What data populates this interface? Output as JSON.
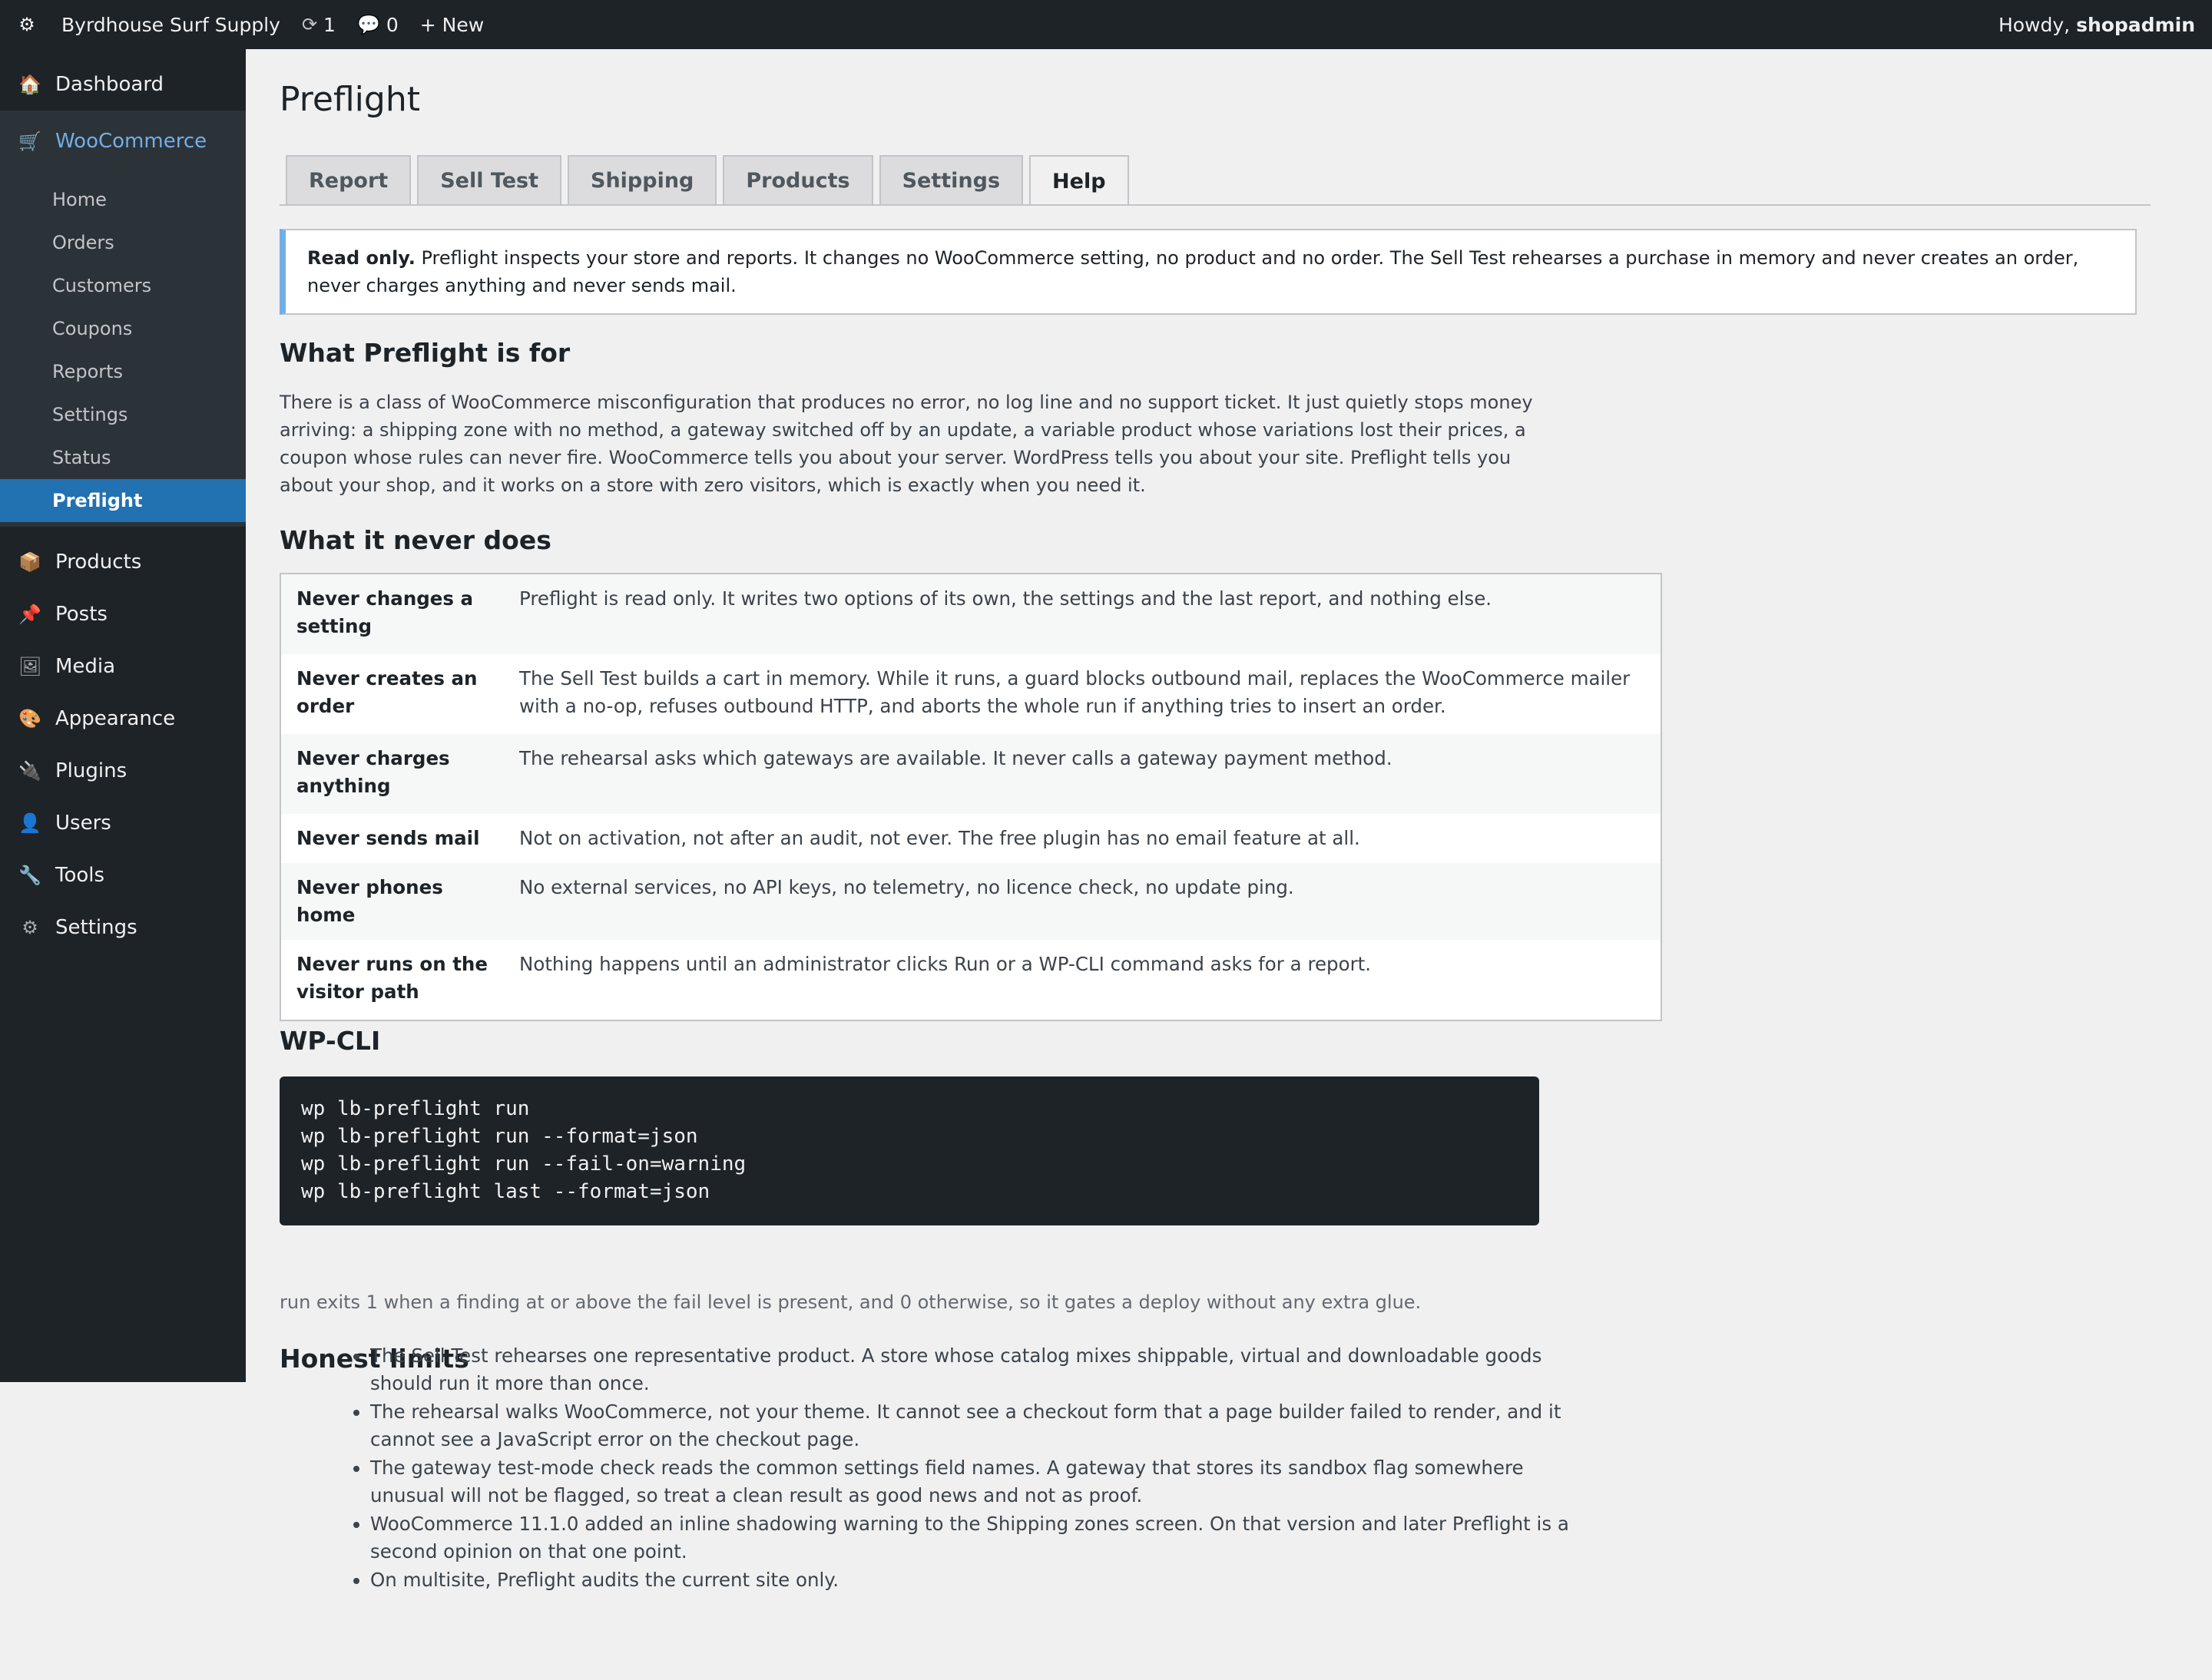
{
  "adminbar": {
    "site_name": "Byrdhouse Surf Supply",
    "updates_count": "1",
    "comments_count": "0",
    "new_label": "+ New",
    "howdy_prefix": "Howdy,",
    "username": "shopadmin"
  },
  "sidebar": {
    "top_items": [
      {
        "label": "Dashboard",
        "icon": "dashboard-icon"
      },
      {
        "label": "WooCommerce",
        "icon": "cart-icon"
      }
    ],
    "woo_submenu": [
      "Home",
      "Orders",
      "Customers",
      "Coupons",
      "Reports",
      "Settings",
      "Status",
      "Preflight"
    ],
    "bottom_items": [
      {
        "label": "Products",
        "icon": "box-icon"
      },
      {
        "label": "Posts",
        "icon": "pin-icon"
      },
      {
        "label": "Media",
        "icon": "media-icon"
      },
      {
        "label": "Appearance",
        "icon": "palette-icon"
      },
      {
        "label": "Plugins",
        "icon": "plug-icon"
      },
      {
        "label": "Users",
        "icon": "user-icon"
      },
      {
        "label": "Tools",
        "icon": "wrench-icon"
      },
      {
        "label": "Settings",
        "icon": "gear-icon"
      }
    ]
  },
  "page": {
    "title": "Preflight",
    "tabs": [
      "Report",
      "Sell Test",
      "Shipping",
      "Products",
      "Settings",
      "Help"
    ],
    "active_tab": "Help"
  },
  "notice": {
    "strong": "Read only.",
    "text": "Preflight inspects your store and reports. It changes no WooCommerce setting, no product and no order. The Sell Test rehearses a purchase in memory and never creates an order, never charges anything and never sends mail."
  },
  "what_for": {
    "heading": "What Preflight is for",
    "body": "There is a class of WooCommerce misconfiguration that produces no error, no log line and no support ticket. It just quietly stops money arriving: a shipping zone with no method, a gateway switched off by an update, a variable product whose variations lost their prices, a coupon whose rules can never fire. WooCommerce tells you about your server. WordPress tells you about your site. Preflight tells you about your shop, and it works on a store with zero visitors, which is exactly when you need it."
  },
  "never": {
    "heading": "What it never does",
    "rows": [
      {
        "k": "Never changes a setting",
        "v": "Preflight is read only. It writes two options of its own, the settings and the last report, and nothing else."
      },
      {
        "k": "Never creates an order",
        "v": "The Sell Test builds a cart in memory. While it runs, a guard blocks outbound mail, replaces the WooCommerce mailer with a no-op, refuses outbound HTTP, and aborts the whole run if anything tries to insert an order."
      },
      {
        "k": "Never charges anything",
        "v": "The rehearsal asks which gateways are available. It never calls a gateway payment method."
      },
      {
        "k": "Never sends mail",
        "v": "Not on activation, not after an audit, not ever. The free plugin has no email feature at all."
      },
      {
        "k": "Never phones home",
        "v": "No external services, no API keys, no telemetry, no licence check, no update ping."
      },
      {
        "k": "Never runs on the visitor path",
        "v": "Nothing happens until an administrator clicks Run or a WP-CLI command asks for a report."
      }
    ]
  },
  "cli": {
    "heading": "WP-CLI",
    "lines": [
      "wp lb-preflight run",
      "wp lb-preflight run --format=json",
      "wp lb-preflight run --fail-on=warning",
      "wp lb-preflight last --format=json"
    ],
    "note": "run exits 1 when a finding at or above the fail level is present, and 0 otherwise, so it gates a deploy without any extra glue."
  },
  "limits": {
    "heading": "Honest limits",
    "items": [
      "The Sell Test rehearses one representative product. A store whose catalog mixes shippable, virtual and downloadable goods should run it more than once.",
      "The rehearsal walks WooCommerce, not your theme. It cannot see a checkout form that a page builder failed to render, and it cannot see a JavaScript error on the checkout page.",
      "The gateway test-mode check reads the common settings field names. A gateway that stores its sandbox flag somewhere unusual will not be flagged, so treat a clean result as good news and not as proof.",
      "WooCommerce 11.1.0 added an inline shadowing warning to the Shipping zones screen. On that version and later Preflight is a second opinion on that one point.",
      "On multisite, Preflight audits the current site only."
    ]
  }
}
